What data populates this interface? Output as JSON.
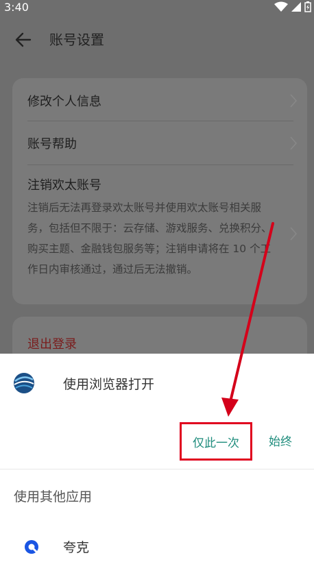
{
  "status_bar": {
    "time": "3:40"
  },
  "header": {
    "title": "账号设置"
  },
  "settings": {
    "items": [
      {
        "label": "修改个人信息"
      },
      {
        "label": "账号帮助"
      },
      {
        "label": "注销欢太账号",
        "description": "注销后无法再登录欢太账号并使用欢太账号相关服务，包括但不限于：云存储、游戏服务、兑换积分、购买主题、金融钱包服务等；注销申请将在 10 个工作日内审核通过，通过后无法撤销。"
      }
    ],
    "logout_label": "退出登录"
  },
  "sheet": {
    "title": "使用浏览器打开",
    "once_label": "仅此一次",
    "always_label": "始终",
    "other_apps_label": "使用其他应用",
    "apps": [
      {
        "label": "夸克"
      }
    ]
  },
  "colors": {
    "accent": "#1e8c7c",
    "highlight_box": "#e0001e",
    "logout": "#7a1c1c"
  }
}
